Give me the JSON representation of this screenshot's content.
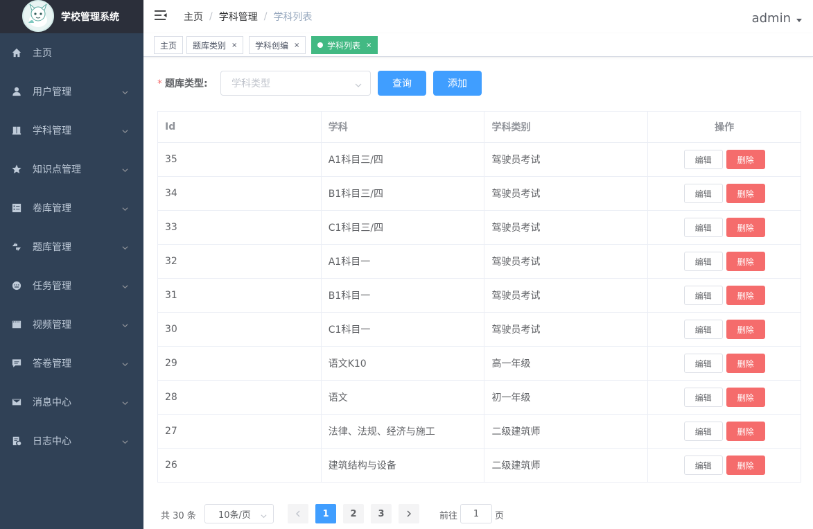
{
  "app": {
    "title": "学校管理系统"
  },
  "sidebar": {
    "items": [
      {
        "label": "主页",
        "icon": "home-icon"
      },
      {
        "label": "用户管理",
        "icon": "user-icon"
      },
      {
        "label": "学科管理",
        "icon": "book-icon"
      },
      {
        "label": "知识点管理",
        "icon": "star-icon"
      },
      {
        "label": "卷库管理",
        "icon": "checklist-icon"
      },
      {
        "label": "题库管理",
        "icon": "sort-icon"
      },
      {
        "label": "任务管理",
        "icon": "keyboard-icon"
      },
      {
        "label": "视频管理",
        "icon": "film-icon"
      },
      {
        "label": "答卷管理",
        "icon": "message-icon"
      },
      {
        "label": "消息中心",
        "icon": "mail-icon"
      },
      {
        "label": "日志中心",
        "icon": "log-icon"
      }
    ]
  },
  "header": {
    "breadcrumb": [
      "主页",
      "学科管理",
      "学科列表"
    ],
    "user": "admin"
  },
  "tags": [
    {
      "label": "主页"
    },
    {
      "label": "题库类别"
    },
    {
      "label": "学科创编"
    },
    {
      "label": "学科列表"
    }
  ],
  "filter": {
    "label": "题库类型:",
    "required_mark": "*",
    "select_placeholder": "学科类型",
    "query_button": "查询",
    "add_button": "添加"
  },
  "table": {
    "columns": [
      "Id",
      "学科",
      "学科类别",
      "操作"
    ],
    "edit_label": "编辑",
    "delete_label": "删除",
    "rows": [
      {
        "id": "35",
        "subject": "A1科目三/四",
        "category": "驾驶员考试"
      },
      {
        "id": "34",
        "subject": "B1科目三/四",
        "category": "驾驶员考试"
      },
      {
        "id": "33",
        "subject": "C1科目三/四",
        "category": "驾驶员考试"
      },
      {
        "id": "32",
        "subject": "A1科目一",
        "category": "驾驶员考试"
      },
      {
        "id": "31",
        "subject": "B1科目一",
        "category": "驾驶员考试"
      },
      {
        "id": "30",
        "subject": "C1科目一",
        "category": "驾驶员考试"
      },
      {
        "id": "29",
        "subject": "语文K10",
        "category": "高一年级"
      },
      {
        "id": "28",
        "subject": "语文",
        "category": "初一年级"
      },
      {
        "id": "27",
        "subject": "法律、法规、经济与施工",
        "category": "二级建筑师"
      },
      {
        "id": "26",
        "subject": "建筑结构与设备",
        "category": "二级建筑师"
      }
    ]
  },
  "pagination": {
    "total_text": "共 30 条",
    "page_size": "10条/页",
    "pages": [
      "1",
      "2",
      "3"
    ],
    "current_page": "1",
    "goto_prefix": "前往",
    "goto_value": "1",
    "goto_suffix": "页"
  },
  "colors": {
    "sidebar_bg": "#304156",
    "primary": "#409eff",
    "danger": "#f56c6c",
    "active_tag": "#42b983"
  }
}
